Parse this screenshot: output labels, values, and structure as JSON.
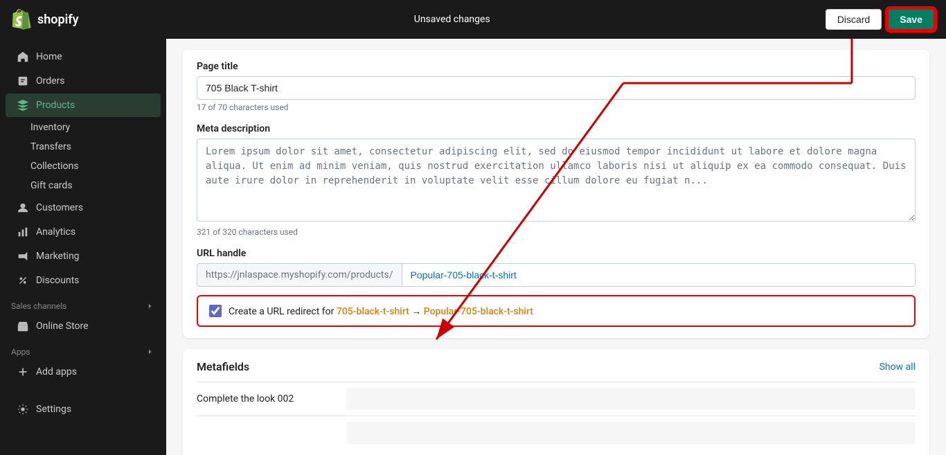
{
  "topbar": {
    "logo_text": "shopify",
    "title": "Unsaved changes",
    "discard_label": "Discard",
    "save_label": "Save"
  },
  "sidebar": {
    "items": [
      {
        "id": "home",
        "label": "Home",
        "icon": "home"
      },
      {
        "id": "orders",
        "label": "Orders",
        "icon": "orders"
      },
      {
        "id": "products",
        "label": "Products",
        "icon": "products",
        "active": true
      },
      {
        "id": "inventory",
        "label": "Inventory",
        "sub": true
      },
      {
        "id": "transfers",
        "label": "Transfers",
        "sub": true
      },
      {
        "id": "collections",
        "label": "Collections",
        "sub": true
      },
      {
        "id": "gift-cards",
        "label": "Gift cards",
        "sub": true
      },
      {
        "id": "customers",
        "label": "Customers",
        "icon": "customers"
      },
      {
        "id": "analytics",
        "label": "Analytics",
        "icon": "analytics"
      },
      {
        "id": "marketing",
        "label": "Marketing",
        "icon": "marketing"
      },
      {
        "id": "discounts",
        "label": "Discounts",
        "icon": "discounts"
      },
      {
        "id": "sales-channels",
        "label": "Sales channels",
        "section": true
      },
      {
        "id": "online-store",
        "label": "Online Store",
        "icon": "store"
      },
      {
        "id": "apps",
        "label": "Apps",
        "section": true
      },
      {
        "id": "add-apps",
        "label": "Add apps",
        "icon": "plus"
      },
      {
        "id": "settings",
        "label": "Settings",
        "icon": "settings",
        "bottom": true
      }
    ]
  },
  "page_title_field": {
    "label": "Page title",
    "value": "705 Black T-shirt",
    "char_count": "17 of 70 characters used"
  },
  "meta_description_field": {
    "label": "Meta description",
    "value": "Lorem ipsum dolor sit amet, consectetur adipiscing elit, sed do eiusmod tempor incididunt ut labore et dolore magna aliqua. Ut enim ad minim veniam, quis nostrud exercitation ullamco laboris nisi ut aliquip ex ea commodo consequat. Duis aute irure dolor in reprehenderit in voluptate velit esse cillum dolore eu fugiat n...",
    "char_count": "321 of 320 characters used"
  },
  "url_handle_field": {
    "label": "URL handle",
    "prefix": "https://jnlaspace.myshopify.com/products/",
    "value": "Popular-705-black-t-shirt"
  },
  "redirect": {
    "checked": true,
    "label": "Create a URL redirect for",
    "old_url": "705-black-t-shirt",
    "arrow": "→",
    "new_url": "Popular-705-black-t-shirt"
  },
  "metafields": {
    "title": "Metafields",
    "show_all": "Show all",
    "rows": [
      {
        "name": "Complete the look 002",
        "value": ""
      }
    ]
  }
}
